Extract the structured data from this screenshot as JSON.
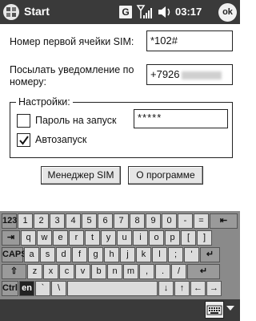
{
  "titlebar": {
    "title": "Start",
    "g_label": "G",
    "time": "03:17",
    "ok_label": "ok",
    "icons": [
      "windows-logo-icon",
      "signal-icon",
      "volume-icon"
    ]
  },
  "form": {
    "sim_cell_label": "Номер первой ячейки SIM:",
    "sim_cell_value": "*102#",
    "notify_label": "Посылать уведомление по номеру:",
    "phone_value": "+7926",
    "settings_legend": "Настройки:",
    "password_label": "Пароль на запуск",
    "password_checked": false,
    "password_value": "*****",
    "autostart_label": "Автозапуск",
    "autostart_checked": true
  },
  "buttons": {
    "sim_manager": "Менеджер SIM",
    "about": "О программе"
  },
  "keyboard": {
    "row1": [
      "123",
      "1",
      "2",
      "3",
      "4",
      "5",
      "6",
      "7",
      "8",
      "9",
      "0",
      "-",
      "=",
      "⇤"
    ],
    "row2": [
      "⇥",
      "q",
      "w",
      "e",
      "r",
      "t",
      "y",
      "u",
      "i",
      "o",
      "p",
      "[",
      "]"
    ],
    "row3": [
      "CAPS",
      "a",
      "s",
      "d",
      "f",
      "g",
      "h",
      "j",
      "k",
      "l",
      ";",
      "'",
      "↵"
    ],
    "row4": [
      "⇧",
      "z",
      "x",
      "c",
      "v",
      "b",
      "n",
      "m",
      ",",
      ".",
      "/",
      "↵"
    ],
    "row5": [
      "Ctrl",
      "en",
      "`",
      "\\",
      "",
      "↓",
      "↑",
      "←",
      "→"
    ],
    "ctrl_label": "Ctrl",
    "lang_label": "en"
  },
  "menubar": {
    "icons": [
      "keyboard-icon",
      "chevron-up-icon"
    ]
  },
  "colors": {
    "titlebar": "#3a3a3a",
    "keyboard_bg": "#8a8a8a",
    "key": "#dcdcdc"
  }
}
